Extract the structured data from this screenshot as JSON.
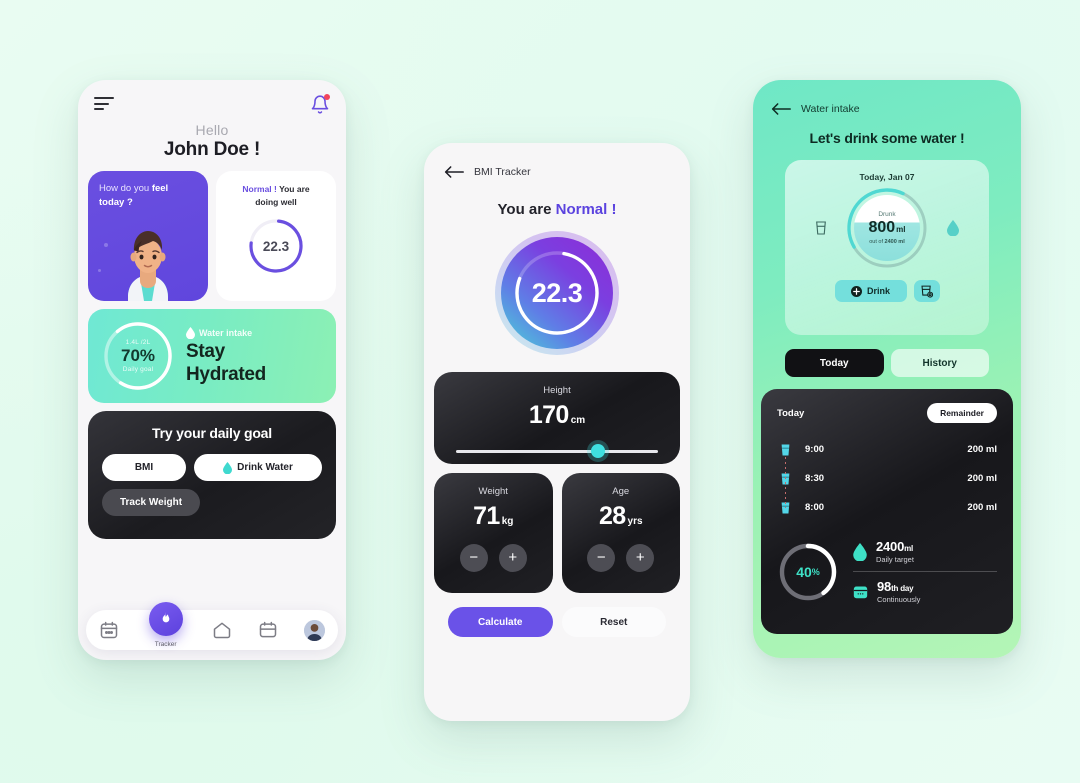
{
  "home": {
    "icons": {
      "menu": "hamburger-icon",
      "bell": "notification-bell-icon"
    },
    "greeting_hello": "Hello",
    "greeting_name": "John Doe !",
    "feel_card": {
      "text_a": "How do you ",
      "text_b": "feel",
      "text_c": "today ?"
    },
    "bmi_card": {
      "caption_hl": "Normal !",
      "caption_rest": " You are doing well",
      "value": "22.3"
    },
    "water_card": {
      "label": "Water intake",
      "title_line1": "Stay",
      "title_line2": "Hydrated",
      "ring_top": "1.4L /2L",
      "ring_pct": "70%",
      "ring_sub": "Daily goal"
    },
    "goal_card": {
      "title": "Try your daily goal",
      "chip_bmi": "BMI",
      "chip_drink": "Drink Water",
      "chip_track": "Track Weight"
    },
    "nav": {
      "items": [
        "calendar-icon",
        "tracker-flame-icon",
        "home-icon",
        "card-icon",
        "profile-avatar"
      ],
      "active_label": "Tracker"
    }
  },
  "bmi": {
    "back": "back-arrow-icon",
    "header_title": "BMI Tracker",
    "status_prefix": "You are ",
    "status_value": "Normal !",
    "gauge_value": "22.3",
    "height": {
      "label": "Height",
      "value": "170",
      "unit": "cm",
      "slider_pct": "67"
    },
    "weight": {
      "label": "Weight",
      "value": "71",
      "unit": "kg",
      "minus": "−",
      "plus": "+"
    },
    "age": {
      "label": "Age",
      "value": "28",
      "unit": "yrs",
      "minus": "−",
      "plus": "+"
    },
    "calculate_label": "Calculate",
    "reset_label": "Reset"
  },
  "water": {
    "back": "back-arrow-icon",
    "header_title": "Water intake",
    "title": "Let's drink some water !",
    "card": {
      "date": "Today, Jan 07",
      "drunk_label": "Drunk",
      "amount": "800",
      "amount_unit": "ml",
      "out_of_prefix": "out of ",
      "out_of_value": "2400 ml",
      "drink_button": "Drink",
      "cup_button": "cup-settings-icon"
    },
    "tabs": {
      "today": "Today",
      "history": "History"
    },
    "list": {
      "header": "Today",
      "remainder_button": "Remainder",
      "rows": [
        {
          "time": "9:00",
          "amount": "200 ml"
        },
        {
          "time": "8:30",
          "amount": "200 ml"
        },
        {
          "time": "8:00",
          "amount": "200 ml"
        }
      ]
    },
    "footer": {
      "progress_pct": "40",
      "progress_sym": "%",
      "target_value": "2400",
      "target_unit": "ml",
      "target_label": "Daily target",
      "days_value": "98",
      "days_suffix": "th day",
      "days_label": "Continuously"
    }
  },
  "colors": {
    "purple": "#6a4fe0",
    "purple_deep": "#5b43df",
    "teal": "#3fe0e0",
    "mint": "#74dfdc",
    "green": "#8cf0b4",
    "dark": "#18181c",
    "bg": "#e6fbef"
  }
}
